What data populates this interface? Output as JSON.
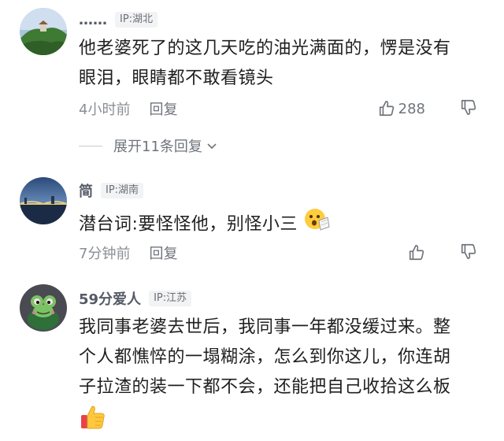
{
  "comments": [
    {
      "username": "……",
      "ip": "IP:湖北",
      "body_line1": "他老婆死了的这几天吃的油光满面的，愣是没有",
      "body_line2": "眼泪，眼睛都不敢看镜头",
      "time": "4小时前",
      "reply": "回复",
      "likes": "288",
      "avatar_icon": "landscape-hill-avatar"
    },
    {
      "username": "简",
      "ip": "IP:湖南",
      "body": "潜台词:要怪怪他，别怪小三",
      "emoji_icon": "surprised-clap-emoji",
      "time": "7分钟前",
      "reply": "回复",
      "avatar_icon": "city-bridge-avatar"
    },
    {
      "username": "59分爱人",
      "ip": "IP:江苏",
      "body_line1": "我同事老婆去世后，我同事一年都没缓过来。整",
      "body_line2": "个人都憔悴的一塌糊涂，怎么到你这儿，你连胡",
      "body_line3": "子拉渣的装一下都不会，还能把自己收拾这么板",
      "emoji_icon": "thumbs-up-emoji",
      "avatar_icon": "cartoon-frog-avatar"
    }
  ],
  "expand_replies": "展开11条回复",
  "colors": {
    "username": "#555b66",
    "meta": "#8a8f96",
    "text": "#1f1f1f",
    "badge_bg": "#f2f3f5"
  }
}
